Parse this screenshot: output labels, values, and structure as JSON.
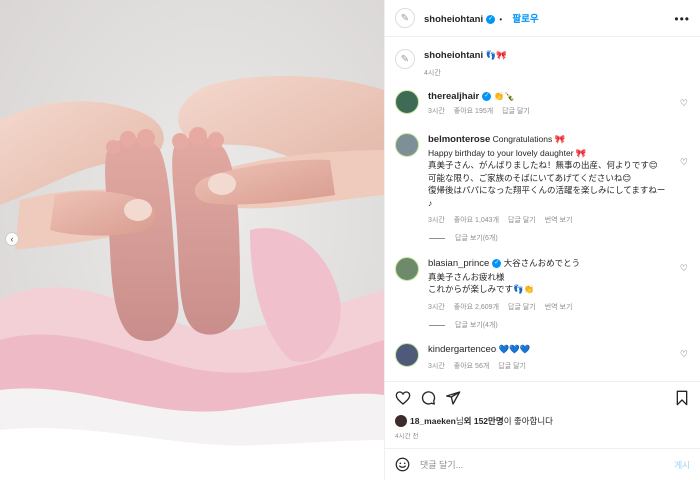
{
  "post": {
    "author": "shoheiohtani",
    "follow_label": "팔로우",
    "more_icon": "more-horizontal-icon",
    "caption_emojis": "👣🎀",
    "time_ago": "4시간",
    "prev_icon": "chevron-left-icon"
  },
  "comments": [
    {
      "user": "therealjhair",
      "text": "👏🍾",
      "time": "3시간",
      "likes": "좋아요 195개",
      "reply": "답글 달기"
    },
    {
      "user": "belmonterose",
      "lines": [
        "Congratulations 🎀",
        "Happy birthday to your lovely daughter 🎀",
        "真美子さん、がんばりましたね！無事の出産、何よりです😊",
        "可能な限り、ご家族のそばにいてあげてくださいね😊",
        "復帰後はパパになった翔平くんの活躍を楽しみにしてますねー",
        "♪"
      ],
      "time": "3시간",
      "likes": "좋아요 1,043개",
      "reply": "답글 달기",
      "translate": "번역 보기",
      "view_replies": "답글 보기(6개)"
    },
    {
      "user": "blasian_prince",
      "lines": [
        "大谷さんおめでとう",
        "真美子さんお疲れ様",
        "これからが楽しみです👣👏"
      ],
      "time": "3시간",
      "likes": "좋아요 2,609개",
      "reply": "답글 달기",
      "translate": "번역 보기",
      "view_replies": "답글 보기(4개)"
    },
    {
      "user": "kindergartenceo",
      "text": "💙💙💙",
      "time": "3시간",
      "likes": "좋아요 56개",
      "reply": "답글 달기"
    }
  ],
  "actions": {
    "like_icon": "heart-icon",
    "comment_icon": "comment-icon",
    "share_icon": "send-icon",
    "save_icon": "bookmark-icon",
    "liker": "18_maeken",
    "likes_mid": "님 ",
    "likes_bold": "외 152만명",
    "likes_tail": "이 좋아합니다",
    "time_ago": "4시간 전"
  },
  "composer": {
    "emoji_icon": "smile-icon",
    "placeholder": "댓글 달기...",
    "post_label": "게시"
  },
  "colors": {
    "accent": "#0095f6",
    "muted": "#8e8e8e",
    "border": "#efefef"
  }
}
